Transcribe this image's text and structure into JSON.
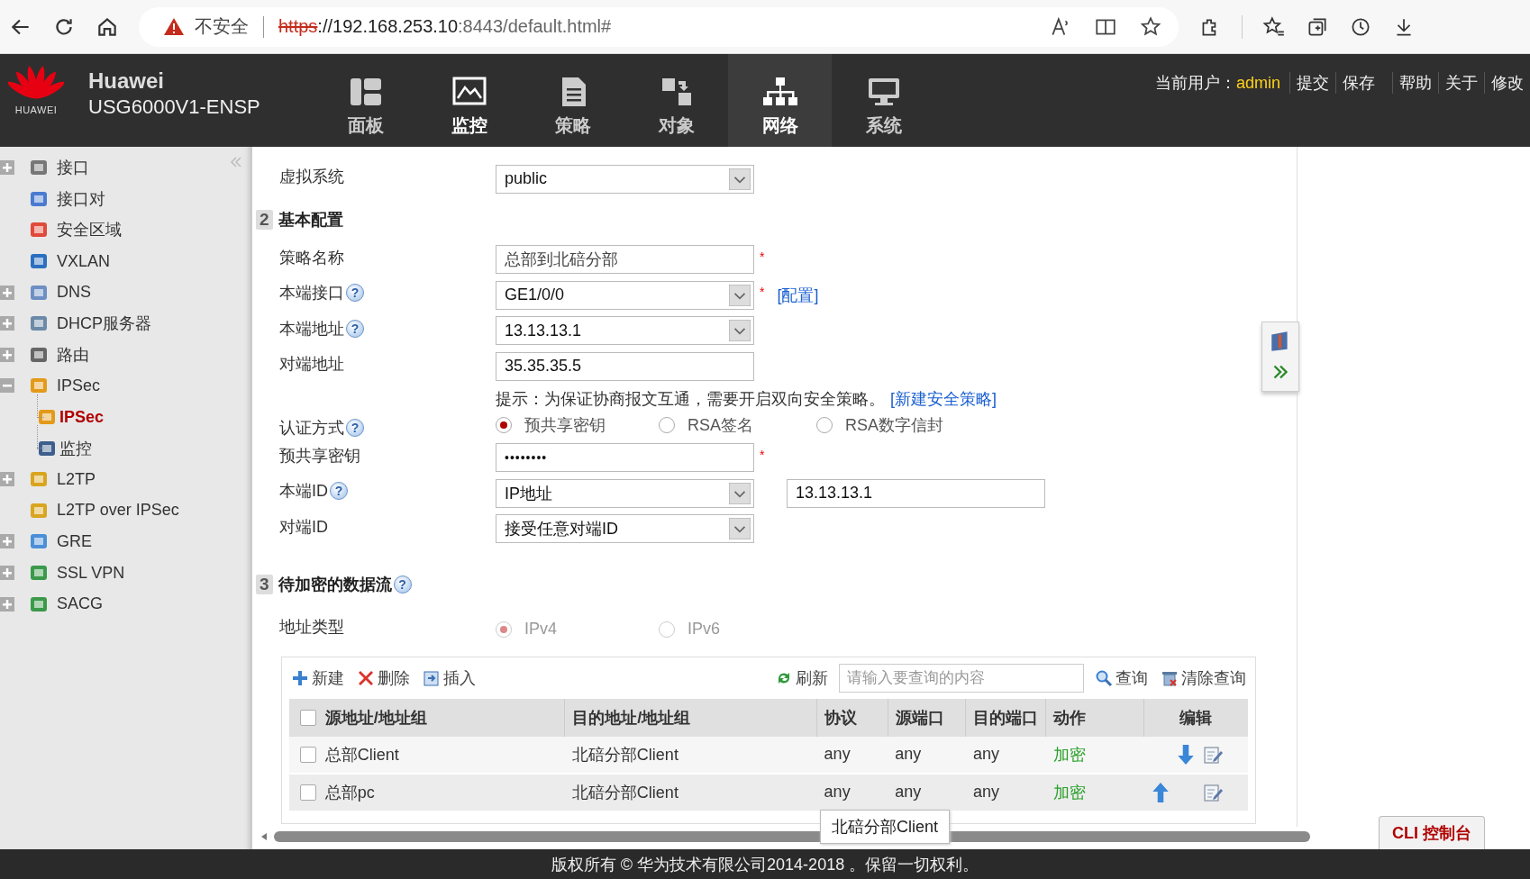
{
  "browser": {
    "warning": "不安全",
    "url_scheme": "https",
    "url_host": "://192.168.253.10",
    "url_rest": ":8443/default.html#"
  },
  "header": {
    "brand": "HUAWEI",
    "product": "Huawei",
    "model": "USG6000V1-ENSP",
    "nav": [
      {
        "label": "面板",
        "selected": false,
        "hovered": false
      },
      {
        "label": "监控",
        "selected": false,
        "hovered": true
      },
      {
        "label": "策略",
        "selected": false,
        "hovered": false
      },
      {
        "label": "对象",
        "selected": false,
        "hovered": false
      },
      {
        "label": "网络",
        "selected": true,
        "hovered": false
      },
      {
        "label": "系统",
        "selected": false,
        "hovered": false
      }
    ],
    "user_label": "当前用户：",
    "user": "admin",
    "links": [
      "提交",
      "保存",
      "帮助",
      "关于",
      "修改"
    ]
  },
  "sidebar": {
    "items": [
      {
        "label": "接口",
        "expandable": true,
        "expanded": false,
        "selected": false
      },
      {
        "label": "接口对",
        "expandable": false,
        "selected": false
      },
      {
        "label": "安全区域",
        "expandable": false,
        "selected": false
      },
      {
        "label": "VXLAN",
        "expandable": false,
        "selected": false
      },
      {
        "label": "DNS",
        "expandable": true,
        "expanded": false,
        "selected": false
      },
      {
        "label": "DHCP服务器",
        "expandable": true,
        "expanded": false,
        "selected": false
      },
      {
        "label": "路由",
        "expandable": true,
        "expanded": false,
        "selected": false
      },
      {
        "label": "IPSec",
        "expandable": true,
        "expanded": true,
        "selected": false,
        "children": [
          {
            "label": "IPSec",
            "selected": true
          },
          {
            "label": "监控",
            "selected": false
          }
        ]
      },
      {
        "label": "L2TP",
        "expandable": true,
        "expanded": false,
        "selected": false
      },
      {
        "label": "L2TP over IPSec",
        "expandable": false,
        "selected": false
      },
      {
        "label": "GRE",
        "expandable": true,
        "expanded": false,
        "selected": false
      },
      {
        "label": "SSL VPN",
        "expandable": true,
        "expanded": false,
        "selected": false
      },
      {
        "label": "SACG",
        "expandable": true,
        "expanded": false,
        "selected": false
      }
    ]
  },
  "form": {
    "vsys": {
      "label": "虚拟系统",
      "value": "public"
    },
    "section2": {
      "number": "2",
      "title": "基本配置"
    },
    "fields": [
      {
        "kind": "text",
        "label": "策略名称",
        "value": "总部到北碚分部",
        "required_mark": "*"
      },
      {
        "kind": "select",
        "label": "本端接口",
        "help": "?",
        "value": "GE1/0/0",
        "required_mark": "*",
        "link": "[配置]"
      },
      {
        "kind": "select",
        "label": "本端地址",
        "help": "?",
        "value": "13.13.13.1"
      },
      {
        "kind": "text",
        "label": "对端地址",
        "value": "35.35.35.5"
      }
    ],
    "hint": "提示：为保证协商报文互通，需要开启双向安全策略。",
    "hint_link": "[新建安全策略]",
    "auth": {
      "label": "认证方式",
      "help": "?",
      "options": [
        {
          "label": "预共享密钥",
          "selected": true
        },
        {
          "label": "RSA签名",
          "selected": false
        },
        {
          "label": "RSA数字信封",
          "selected": false
        }
      ]
    },
    "fields2": [
      {
        "kind": "password",
        "label": "预共享密钥",
        "value": "••••••••",
        "required_mark": "*"
      },
      {
        "kind": "select",
        "label": "本端ID",
        "help": "?",
        "value": "IP地址",
        "extra": "13.13.13.1"
      },
      {
        "kind": "select",
        "label": "对端ID",
        "value": "接受任意对端ID"
      }
    ],
    "section3": {
      "number": "3",
      "title": "待加密的数据流",
      "help": "?"
    },
    "addr_type": {
      "label": "地址类型",
      "disabled": true,
      "options": [
        {
          "label": "IPv4",
          "selected": true
        },
        {
          "label": "IPv6",
          "selected": false
        }
      ]
    }
  },
  "table": {
    "toolbar": [
      {
        "kind": "add",
        "label": "新建"
      },
      {
        "kind": "delete",
        "label": "删除"
      },
      {
        "kind": "insert",
        "label": "插入"
      }
    ],
    "select_all_checked": false,
    "refresh": "刷新",
    "search_placeholder": "请输入要查询的内容",
    "search": "查询",
    "clear": "清除查询",
    "columns": [
      "源地址/地址组",
      "目的地址/地址组",
      "协议",
      "源端口",
      "目的端口",
      "动作",
      "编辑"
    ],
    "rows": [
      {
        "checked": false,
        "src": "总部Client",
        "dst": "北碚分部Client",
        "proto": "any",
        "sport": "any",
        "dport": "any",
        "action": "加密",
        "can_move_up": false,
        "can_move_down": true
      },
      {
        "checked": false,
        "src": "总部pc",
        "dst": "北碚分部Client",
        "proto": "any",
        "sport": "any",
        "dport": "any",
        "action": "加密",
        "can_move_up": true,
        "can_move_down": false
      }
    ],
    "tooltip": "北碚分部Client"
  },
  "cli_button": "CLI 控制台",
  "footer": "版权所有 © 华为技术有限公司2014-2018 。保留一切权利。"
}
